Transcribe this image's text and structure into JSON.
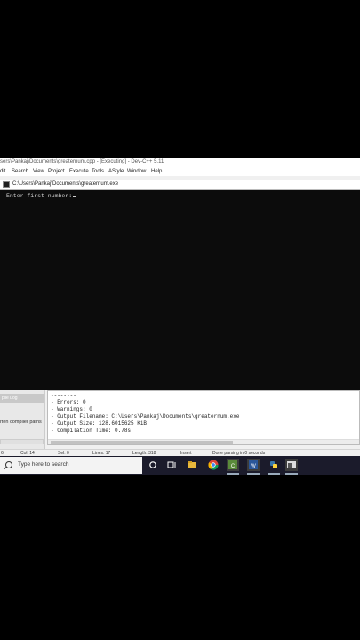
{
  "window": {
    "title": "sers\\Pankaj\\Documents\\greaternum.cpp - [Executing] - Dev-C++ 5.11"
  },
  "menu": [
    "dit",
    "Search",
    "View",
    "Project",
    "Execute",
    "Tools",
    "AStyle",
    "Window",
    "Help"
  ],
  "console": {
    "title": "C:\\Users\\Pankaj\\Documents\\greaternum.exe",
    "text": "Enter first number:"
  },
  "left_panel": {
    "tab": "pile Log",
    "text": "rten compiler paths"
  },
  "compile_log": [
    "--------",
    "- Errors: 0",
    "- Warnings: 0",
    "- Output Filename: C:\\Users\\Pankaj\\Documents\\greaternum.exe",
    "- Output Size: 128.6015625 KiB",
    "- Compilation Time: 0.78s"
  ],
  "status": {
    "line": "6",
    "col": "Col:   14",
    "sel": "Sel:    0",
    "lines": "Lines:    17",
    "length": "Length:   318",
    "mode": "Insert",
    "message": "Done parsing in 0 seconds"
  },
  "taskbar": {
    "search_placeholder": "Type here to search",
    "icons": [
      "cortana-icon",
      "task-view-icon",
      "file-explorer-icon",
      "chrome-icon",
      "devcpp-icon",
      "word-icon",
      "python-icon",
      "console-app-icon"
    ]
  }
}
